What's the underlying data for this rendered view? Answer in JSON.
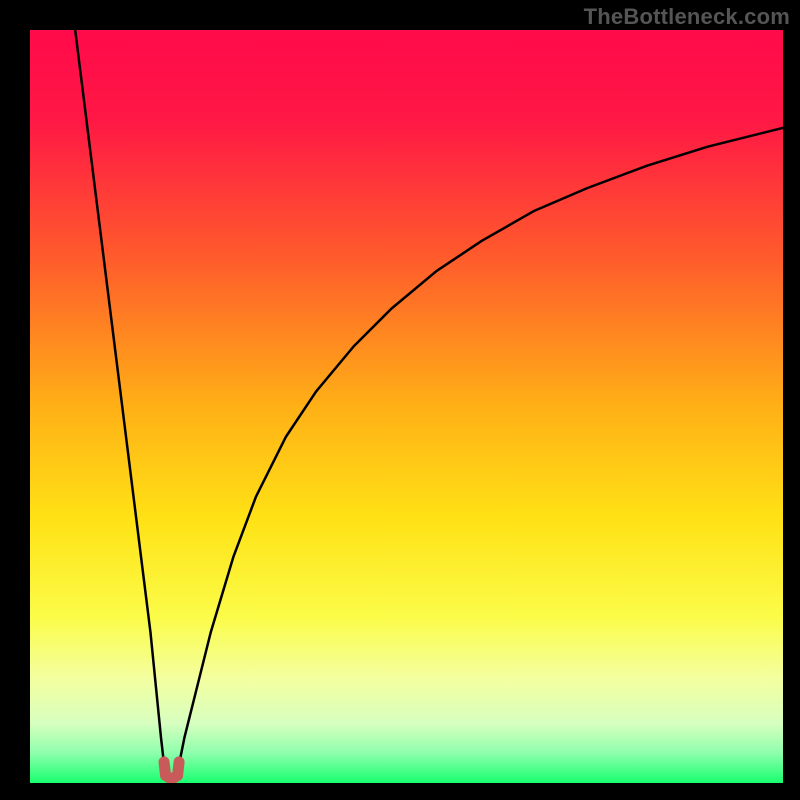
{
  "watermark": "TheBottleneck.com",
  "chart_data": {
    "type": "line",
    "title": "",
    "xlabel": "",
    "ylabel": "",
    "xlim": [
      0,
      100
    ],
    "ylim": [
      0,
      100
    ],
    "grid": false,
    "legend": false,
    "gradient_stops": [
      {
        "offset": 0,
        "color": "#ff0a4a"
      },
      {
        "offset": 12,
        "color": "#ff1845"
      },
      {
        "offset": 30,
        "color": "#ff5a2c"
      },
      {
        "offset": 50,
        "color": "#ffb016"
      },
      {
        "offset": 65,
        "color": "#ffe215"
      },
      {
        "offset": 78,
        "color": "#fbfc49"
      },
      {
        "offset": 86,
        "color": "#f4ff9f"
      },
      {
        "offset": 92,
        "color": "#d8ffbf"
      },
      {
        "offset": 96,
        "color": "#8fffad"
      },
      {
        "offset": 100,
        "color": "#17ff6f"
      }
    ],
    "series": [
      {
        "name": "left-branch",
        "stroke": "#000000",
        "stroke_width": 2.5,
        "x": [
          6.0,
          7.0,
          8.0,
          9.0,
          10.0,
          11.0,
          12.0,
          13.0,
          14.0,
          15.0,
          16.0,
          16.8,
          17.4,
          17.8
        ],
        "y": [
          100,
          92,
          84,
          76,
          68,
          60,
          52,
          44,
          36,
          28,
          20,
          12,
          6,
          2.5
        ]
      },
      {
        "name": "right-branch",
        "stroke": "#000000",
        "stroke_width": 2.5,
        "x": [
          19.8,
          20.5,
          22,
          24,
          27,
          30,
          34,
          38,
          43,
          48,
          54,
          60,
          67,
          74,
          82,
          90,
          100
        ],
        "y": [
          2.5,
          6,
          12,
          20,
          30,
          38,
          46,
          52,
          58,
          63,
          68,
          72,
          76,
          79,
          82,
          84.5,
          87
        ]
      },
      {
        "name": "minimum-marker",
        "stroke": "#c85a5a",
        "stroke_width": 11,
        "linecap": "round",
        "x": [
          17.8,
          18.0,
          18.8,
          19.6,
          19.8
        ],
        "y": [
          2.8,
          1.0,
          0.5,
          1.0,
          2.8
        ]
      }
    ]
  }
}
